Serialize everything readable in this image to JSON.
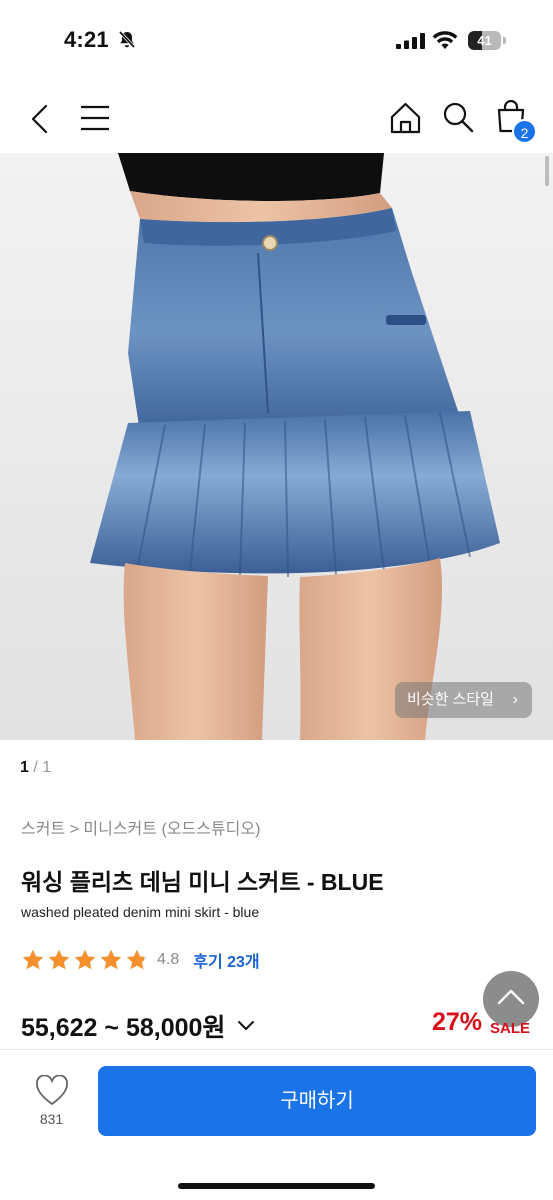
{
  "status_bar": {
    "time": "4:21",
    "battery_level": "41",
    "battery_fraction": 0.41
  },
  "nav": {
    "cart_count": "2"
  },
  "image": {
    "similar_style_label": "비슷한 스타일",
    "page_current": "1",
    "page_total": "/ 1"
  },
  "product": {
    "breadcrumb": "스커트 > 미니스커트 (오드스튜디오)",
    "title": "워싱 플리츠 데님 미니 스커트 - BLUE",
    "subtitle": "washed pleated denim mini skirt - blue",
    "rating": "4.8",
    "rating_stars": 4.8,
    "review_link": "후기 23개",
    "price_range": "55,622 ~ 58,000원",
    "discount": "27%",
    "sale_label": "SALE"
  },
  "bottom_bar": {
    "like_count": "831",
    "buy_label": "구매하기"
  },
  "colors": {
    "accent": "#1a73e8",
    "discount_red": "#d80f1b",
    "star_orange": "#f4902e",
    "review_blue": "#1a62d6"
  },
  "icons": [
    "bell-off-icon",
    "signal-icon",
    "wifi-icon",
    "battery-icon",
    "back-icon",
    "menu-icon",
    "home-icon",
    "search-icon",
    "cart-icon",
    "chevron-right-icon",
    "star-icon",
    "chevron-down-icon",
    "arrow-up-icon",
    "heart-icon"
  ]
}
